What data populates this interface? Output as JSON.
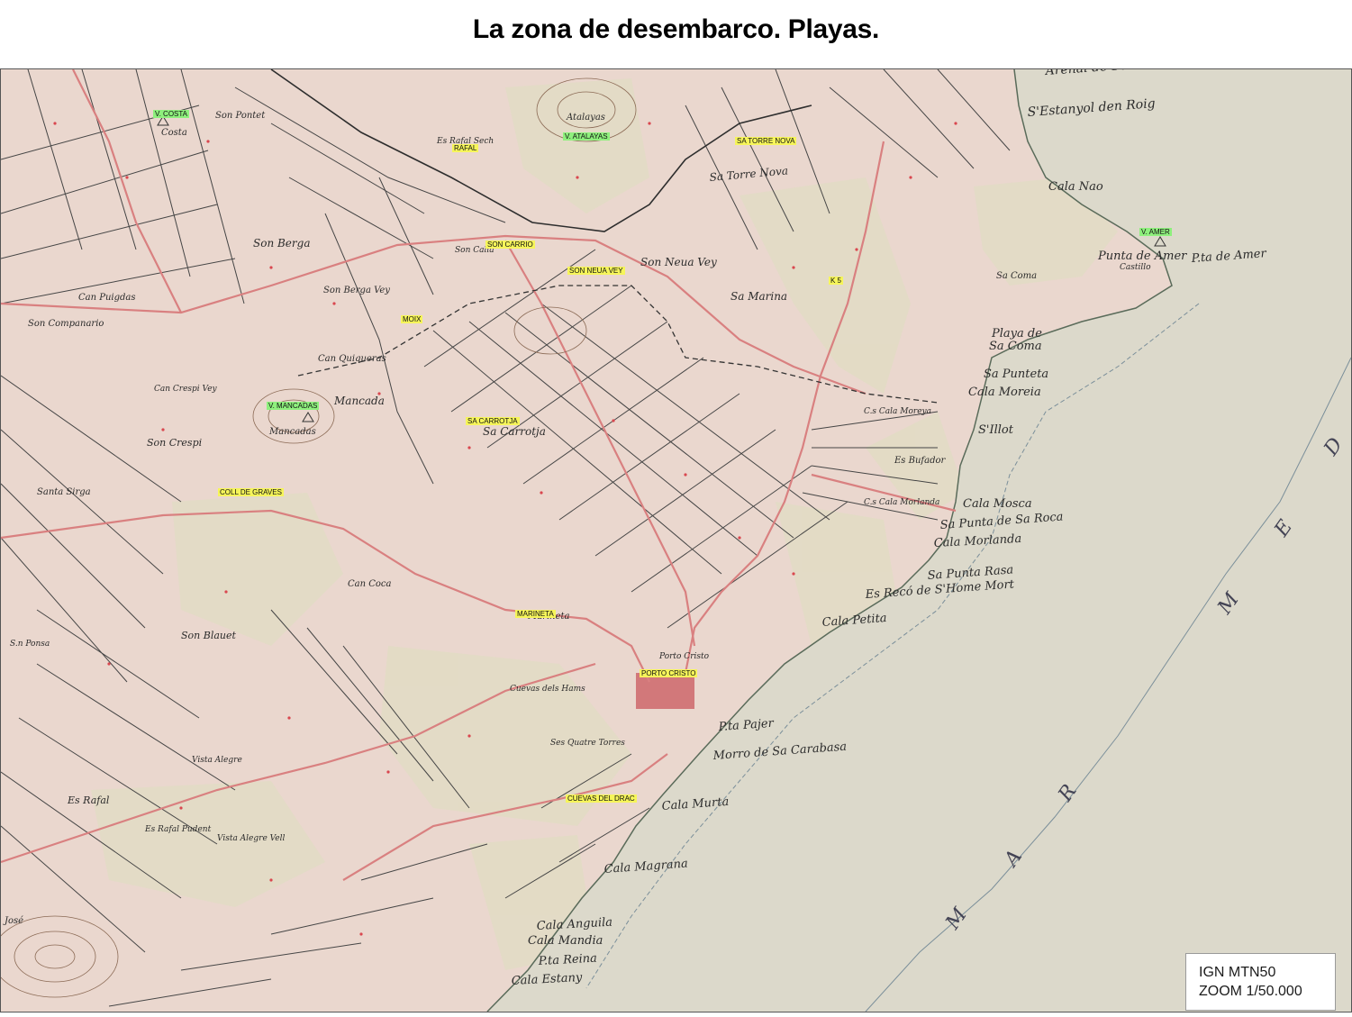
{
  "title": "La zona de desembarco. Playas.",
  "highlighted_labels": {
    "v_costa": "V. COSTA",
    "rafal": "RAFAL",
    "v_atalayas": "V. ATALAYAS",
    "sa_torre_nova": "SA TORRE NOVA",
    "v_amer": "V. AMER",
    "son_carrio": "SON CARRIO",
    "son_neua_vey": "SON NEUA VEY",
    "k5": "K 5",
    "moix": "MOIX",
    "v_mancadas": "V. MANCADAS",
    "sa_carrotja": "SA CARROTJA",
    "coll_de_graves": "COLL DE GRAVES",
    "marineta": "MARINETA",
    "porto_cristo": "PORTO CRISTO",
    "cuevas_del_drac": "CUEVAS DEL DRAC"
  },
  "map_labels": {
    "arenal_de_son_servera": "Arenal de Son Servera",
    "estanyol_den_roig": "S'Estanyol den Roig",
    "cala_nao": "Cala Nao",
    "punta_de_amer": "Punta de Amer",
    "castillo": "Castillo",
    "pta_de_amer": "P.ta de Amer",
    "sa_coma": "Sa Coma",
    "playa_de": "Playa de",
    "playa_sa_coma": "Sa Coma",
    "sa_punteta": "Sa Punteta",
    "cala_moreia": "Cala Moreia",
    "sillot": "S'Illot",
    "es_bufador": "Es Bufador",
    "cala_mosca": "Cala Mosca",
    "sa_punta_de_sa_roca": "Sa Punta de Sa Roca",
    "cala_morlanda": "Cala Morlanda",
    "sa_punta_rasa": "Sa Punta Rasa",
    "es_reco": "Es Recó de S'Home Mort",
    "cala_petita": "Cala Petita",
    "pta_pajer": "P.ta Pajer",
    "morro_de_sa_carabasa": "Morro de Sa Carabasa",
    "cala_murta": "Cala Murta",
    "cala_magrana": "Cala Magrana",
    "cala_anguila": "Cala Anguila",
    "cala_mandia": "Cala Mandia",
    "pta_reina": "P.ta Reina",
    "cala_estany": "Cala Estany",
    "atalayas": "Atalayas",
    "costa": "Costa",
    "son_pontet": "Son Pontet",
    "es_rafal_sech": "Es Rafal Sech",
    "sa_torre_nova": "Sa Torre Nova",
    "son_berga": "Son Berga",
    "son_berga_vey": "Son Berga Vey",
    "can_puigdas": "Can Puigdas",
    "son_companario": "Son Companario",
    "son_neua_vey": "Son Neua Vey",
    "sa_marina": "Sa Marina",
    "can_quiqueras": "Can Quiqueras",
    "mancada": "Mancada",
    "mancadas": "Mancadas",
    "can_crespi_vey": "Can Crespi Vey",
    "son_crespi": "Son Crespi",
    "santa_sirga": "Santa Sirga",
    "sa_carrotja": "Sa Carrotja",
    "can_coca": "Can Coca",
    "son_blauet": "Son Blauet",
    "marineta": "Marineta",
    "cuevas_dels_hams": "Cuevas dels Hams",
    "porto_cristo": "Porto Cristo",
    "ses_quatre_torres": "Ses Quatre Torres",
    "vista_alegre": "Vista Alegre",
    "vista_alegre_vell": "Vista Alegre Vell",
    "es_rafal": "Es Rafal",
    "es_rafal_pudent": "Es Rafal Pudent",
    "son_calla": "Son Calla",
    "cala_morlanda_land": "C.s Cala Morlanda",
    "cala_moreya_land": "C.s Cala Moreya",
    "son_ponsa": "S.n Ponsa",
    "jose": "José",
    "sea_m": "M",
    "sea_a": "A",
    "sea_r": "R",
    "sea_m2": "M",
    "sea_e": "E",
    "sea_d": "D"
  },
  "legend": {
    "line1": "IGN MTN50",
    "line2": "ZOOM 1/50.000"
  },
  "colors": {
    "land": "#ead7ce",
    "sea": "#dcd9cb",
    "road": "#d98080",
    "track": "#3f3f3f",
    "highlight_yellow": "#f6f55a",
    "highlight_green": "#8ef07d"
  }
}
